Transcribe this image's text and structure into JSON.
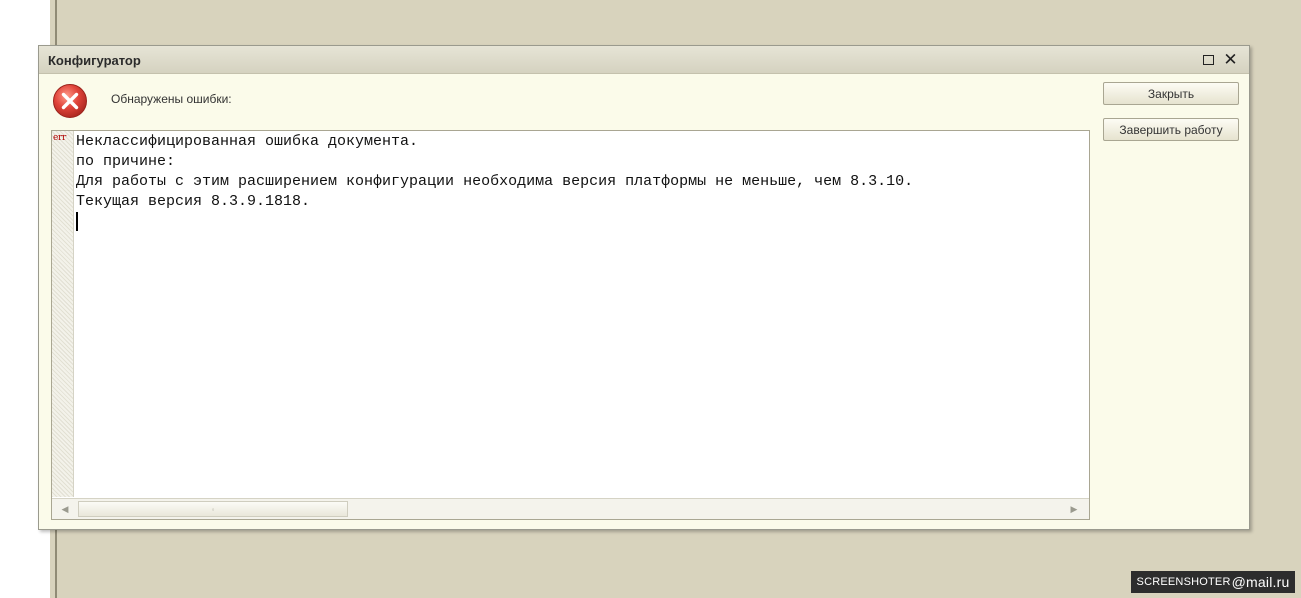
{
  "window": {
    "title": "Конфигуратор"
  },
  "message": {
    "label": "Обнаружены ошибки:",
    "err_tag": "err"
  },
  "buttons": {
    "close_label": "Закрыть",
    "exit_label": "Завершить работу"
  },
  "editor": {
    "lines": [
      "Неклассифицированная ошибка документа.",
      "по причине:",
      "Для работы с этим расширением конфигурации необходима версия платформы не меньше, чем 8.3.10.",
      "Текущая версия 8.3.9.1818."
    ]
  },
  "watermark": {
    "main": "SCREENSHOTER",
    "mail": "@mail.ru"
  },
  "colors": {
    "background": "#d8d3bd",
    "dialog": "#fbfbea",
    "error_red": "#e0443a"
  },
  "icons": {
    "error": "error-circle-icon",
    "maximize": "maximize-icon",
    "close": "close-icon",
    "scroll_left": "arrow-left-icon",
    "scroll_right": "arrow-right-icon"
  }
}
